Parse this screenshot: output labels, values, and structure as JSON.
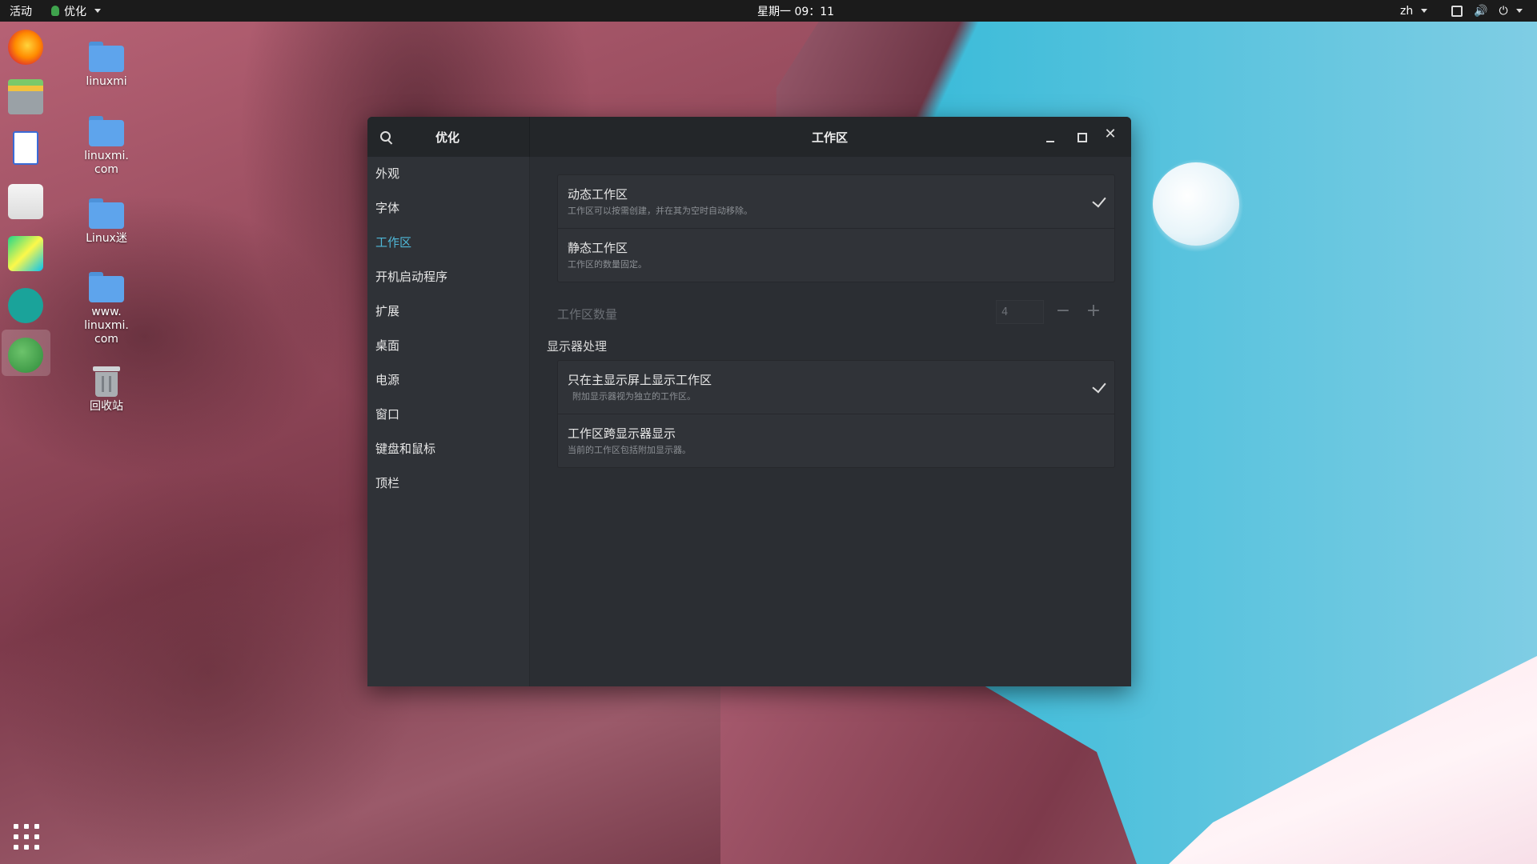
{
  "topbar": {
    "activities": "活动",
    "app_menu": "优化",
    "clock": "星期一 09：11",
    "language": "zh"
  },
  "desktop": {
    "icons": [
      {
        "label": "linuxmi",
        "type": "folder"
      },
      {
        "label": "linuxmi.\ncom",
        "type": "folder"
      },
      {
        "label": "Linux迷",
        "type": "folder"
      },
      {
        "label": "www.\nlinuxmi.\ncom",
        "type": "folder"
      },
      {
        "label": "回收站",
        "type": "trash"
      }
    ]
  },
  "dock": {
    "items": [
      "firefox-icon",
      "files-icon",
      "text-editor-icon",
      "software-center-icon",
      "pycharm-icon",
      "aperture-icon",
      "tweaks-icon"
    ],
    "app_grid": "app-grid-icon"
  },
  "window": {
    "sidebar_title": "优化",
    "title": "工作区",
    "nav": [
      "外观",
      "字体",
      "工作区",
      "开机启动程序",
      "扩展",
      "桌面",
      "电源",
      "窗口",
      "键盘和鼠标",
      "顶栏"
    ],
    "active_nav": "工作区",
    "workspaces": {
      "dynamic": {
        "title": "动态工作区",
        "subtitle": "工作区可以按需创建，并在其为空时自动移除。",
        "checked": true
      },
      "static": {
        "title": "静态工作区",
        "subtitle": "工作区的数量固定。",
        "checked": false
      },
      "count_label": "工作区数量",
      "count_value": "4"
    },
    "display_section": "显示器处理",
    "display": {
      "primary_only": {
        "title": "只在主显示屏上显示工作区",
        "subtitle": "附加显示器视为独立的工作区。",
        "checked": true
      },
      "span": {
        "title": "工作区跨显示器显示",
        "subtitle": "当前的工作区包括附加显示器。",
        "checked": false
      }
    }
  },
  "colors": {
    "accent": "#4fb8d8",
    "window_bg": "#2b2e33",
    "topbar_bg": "#1b1b1b"
  }
}
